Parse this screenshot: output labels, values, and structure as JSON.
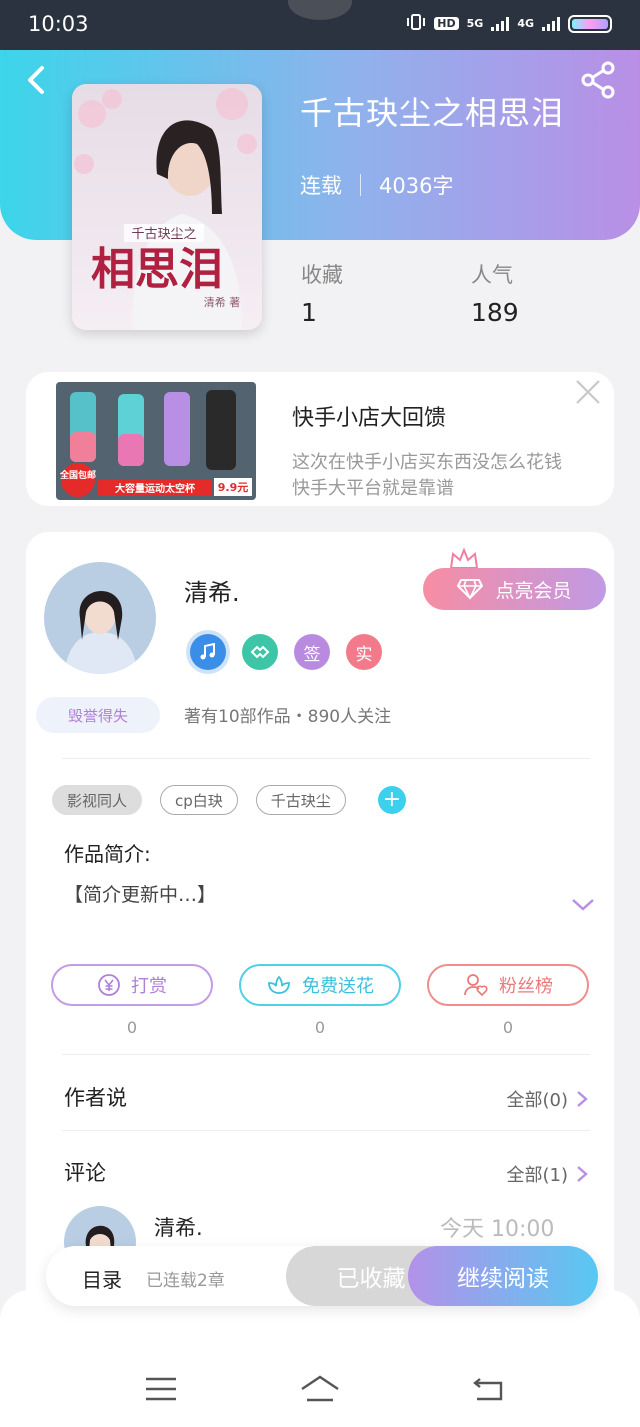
{
  "status_bar": {
    "time": "10:03",
    "network": "5G",
    "network2": "4G",
    "hd_label": "HD"
  },
  "book": {
    "title": "千古玦尘之相思泪",
    "status": "连载",
    "word_count": "4036字",
    "cover_title_small": "千古玦尘之",
    "cover_title_big": "相思泪",
    "cover_author": "清希 著",
    "stats": {
      "collect_label": "收藏",
      "collect_value": "1",
      "popularity_label": "人气",
      "popularity_value": "189"
    }
  },
  "ad": {
    "title": "快手小店大回馈",
    "desc_line1": "这次在快手小店买东西没怎么花钱",
    "desc_line2": "快手大平台就是靠谱",
    "img_tag": "全国包邮",
    "img_banner": "大容量运动太空杯",
    "img_price": "9.9元"
  },
  "author": {
    "name": "清希.",
    "vip_button": "点亮会员",
    "badges": [
      {
        "name": "music-badge-icon",
        "label": "",
        "color": "#3a8ee8"
      },
      {
        "name": "handshake-badge-icon",
        "label": "",
        "color": "#3cc5a6"
      },
      {
        "name": "sign-badge",
        "label": "签",
        "color": "#b98be0"
      },
      {
        "name": "real-badge",
        "label": "实",
        "color": "#f27a8a"
      }
    ],
    "honor_tag": "毁誉得失",
    "works": "著有10部作品・890人关注"
  },
  "tags": [
    "影视同人",
    "cp白玦",
    "千古玦尘"
  ],
  "intro": {
    "title": "作品简介:",
    "body": "【简介更新中…】"
  },
  "actions": [
    {
      "label": "打赏",
      "count": "0",
      "color": "#c49be8"
    },
    {
      "label": "免费送花",
      "count": "0",
      "color": "#4fd0e8"
    },
    {
      "label": "粉丝榜",
      "count": "0",
      "color": "#f08c8c"
    }
  ],
  "author_says": {
    "title": "作者说",
    "link": "全部(0)"
  },
  "comments": {
    "title": "评论",
    "link": "全部(1)",
    "first": {
      "name": "清希.",
      "time": "今天  10:00"
    }
  },
  "bottom_bar": {
    "toc": "目录",
    "toc_sub": "已连载2章",
    "collected": "已收藏",
    "continue": "继续阅读"
  },
  "colors": {
    "accent_cyan": "#3cd5ea",
    "accent_purple": "#b98fe6"
  }
}
